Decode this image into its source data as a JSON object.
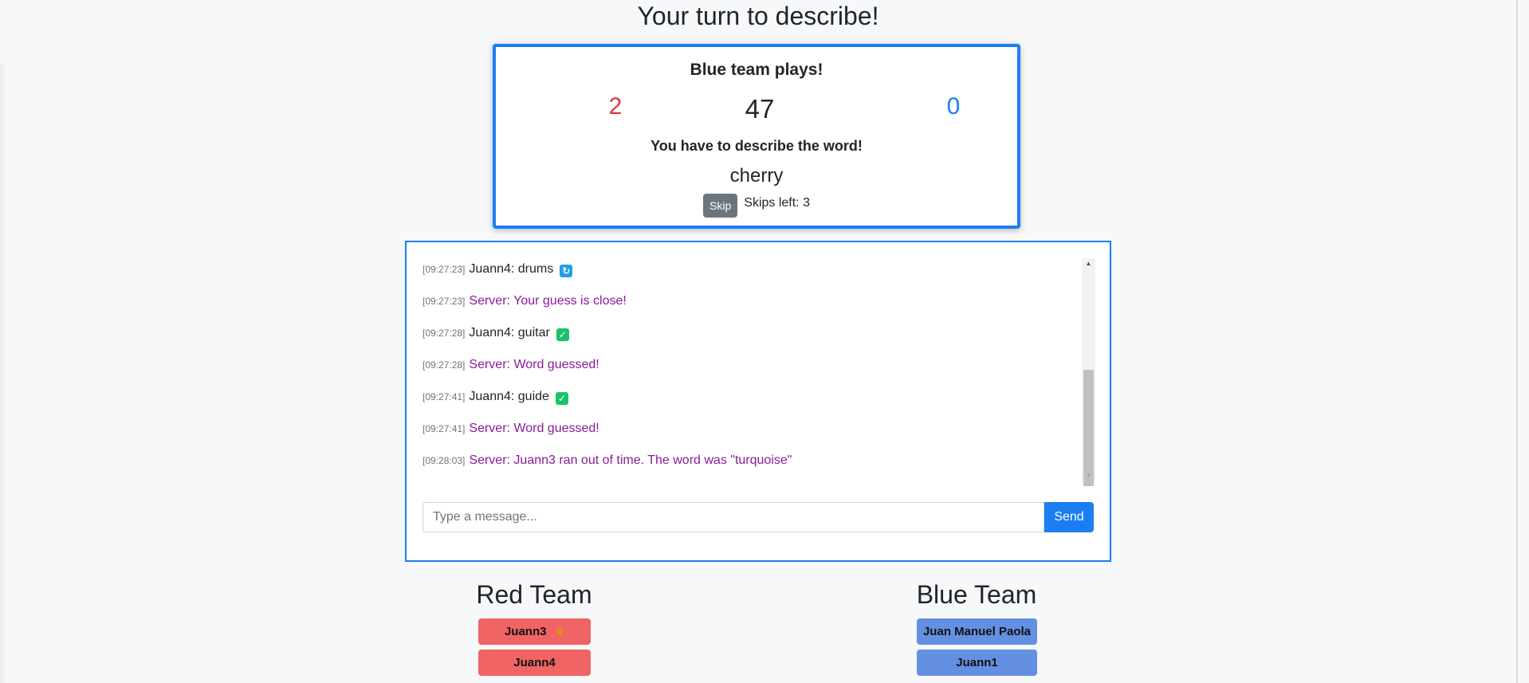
{
  "header": {
    "title": "Your turn to describe!"
  },
  "status": {
    "playing_team": "Blue team plays!",
    "red_score": "2",
    "timer": "47",
    "blue_score": "0",
    "instruction": "You have to describe the word!",
    "word": "cherry",
    "skip_label": "Skip",
    "skips_left": "Skips left: 3"
  },
  "chat": {
    "messages": [
      {
        "time": "[09:27:23]",
        "text": "Juann4: drums",
        "server": false,
        "icon": "repeat-icon"
      },
      {
        "time": "[09:27:23]",
        "text": "Server: Your guess is close!",
        "server": true
      },
      {
        "time": "[09:27:28]",
        "text": "Juann4: guitar",
        "server": false,
        "icon": "check-icon"
      },
      {
        "time": "[09:27:28]",
        "text": "Server: Word guessed!",
        "server": true
      },
      {
        "time": "[09:27:41]",
        "text": "Juann4: guide",
        "server": false,
        "icon": "check-icon"
      },
      {
        "time": "[09:27:41]",
        "text": "Server: Word guessed!",
        "server": true
      },
      {
        "time": "[09:28:03]",
        "text": "Server: Juann3 ran out of time. The word was \"turquoise\"",
        "server": true
      }
    ],
    "input_placeholder": "Type a message...",
    "send_label": "Send"
  },
  "teams": {
    "red": {
      "title": "Red Team",
      "players": [
        "Juann3",
        "Juann4"
      ],
      "leader_icon": "crown-icon"
    },
    "blue": {
      "title": "Blue Team",
      "players": [
        "Juan Manuel Paola",
        "Juann1"
      ]
    }
  },
  "colors": {
    "accent": "#1a7ef2",
    "red_score": "#dc3545",
    "server_message": "#8b1a9b",
    "red_player": "#f06464",
    "blue_player": "#6490e1"
  }
}
